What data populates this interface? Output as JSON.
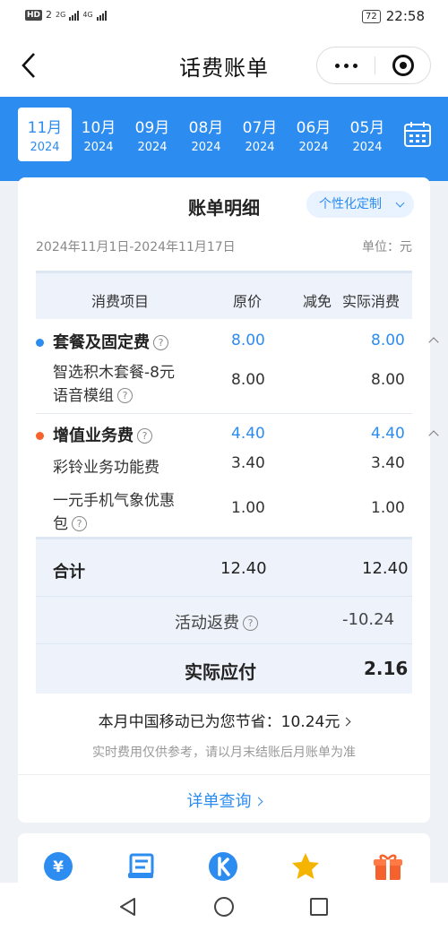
{
  "status_bar": {
    "left_badge": "HD",
    "sim_label": "2",
    "network_1": "2G",
    "network_2": "4G",
    "battery": "72",
    "time": "22:58"
  },
  "header": {
    "title": "话费账单"
  },
  "months": [
    {
      "month": "11月",
      "year": "2024",
      "selected": true
    },
    {
      "month": "10月",
      "year": "2024"
    },
    {
      "month": "09月",
      "year": "2024"
    },
    {
      "month": "08月",
      "year": "2024"
    },
    {
      "month": "07月",
      "year": "2024"
    },
    {
      "month": "06月",
      "year": "2024"
    },
    {
      "month": "05月",
      "year": "2024"
    }
  ],
  "bill": {
    "title": "账单明细",
    "custom_label": "个性化定制",
    "date_range": "2024年11月1日-2024年11月17日",
    "unit": "单位：元",
    "columns": {
      "item": "消费项目",
      "original": "原价",
      "discount": "减免",
      "actual": "实际消费"
    },
    "groups": [
      {
        "name": "套餐及固定费",
        "original": "8.00",
        "actual": "8.00",
        "dot_color": "#2d8cf0",
        "items": [
          {
            "name_line1": "智选积木套餐-8元",
            "name_line2": "语音模组",
            "original": "8.00",
            "actual": "8.00"
          }
        ]
      },
      {
        "name": "增值业务费",
        "original": "4.40",
        "actual": "4.40",
        "dot_color": "#f5622d",
        "items": [
          {
            "name_line1": "彩铃业务功能费",
            "original": "3.40",
            "actual": "3.40"
          },
          {
            "name_line1": "一元手机气象优惠",
            "name_line2": "包",
            "original": "1.00",
            "actual": "1.00"
          }
        ]
      }
    ],
    "total_label": "合计",
    "total_original": "12.40",
    "total_actual": "12.40",
    "rebate_label": "活动返费",
    "rebate_value": "-10.24",
    "payable_label": "实际应付",
    "payable_value": "2.16",
    "savings_text": "本月中国移动已为您节省：10.24元",
    "note": "实时费用仅供参考，请以月末结账后月账单为准",
    "detail_link": "详单查询"
  },
  "quick_icons": [
    {
      "icon": "yuan-coin-icon",
      "color": "#2d8cf0"
    },
    {
      "icon": "bill-list-icon",
      "color": "#2d8cf0"
    },
    {
      "icon": "k-coin-icon",
      "color": "#2d8cf0"
    },
    {
      "icon": "star-icon",
      "color": "#f5b400"
    },
    {
      "icon": "gift-icon",
      "color": "#f5622d"
    }
  ],
  "colors": {
    "accent": "#2d8cf0",
    "orange": "#f5622d"
  }
}
